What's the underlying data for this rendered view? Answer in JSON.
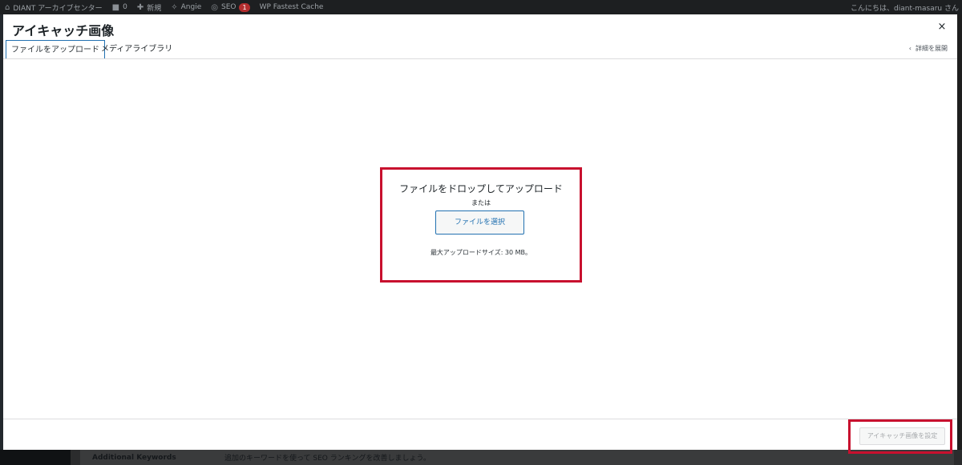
{
  "adminbar": {
    "site_name": "DIANT アーカイブセンター",
    "comments_count": "0",
    "new_label": "新規",
    "angie_label": "Angie",
    "seo_label": "SEO",
    "seo_badge": "1",
    "cache_label": "WP Fastest Cache",
    "greeting": "こんにちは、diant-masaru さん"
  },
  "background": {
    "row_key": "Additional Keywords",
    "row_value": "追加のキーワードを使って SEO ランキングを改善しましょう。"
  },
  "modal": {
    "title": "アイキャッチ画像",
    "close_glyph": "×",
    "tabs": [
      {
        "label": "ファイルをアップロード",
        "active": true
      },
      {
        "label": "メディアライブラリ",
        "active": false
      }
    ],
    "toggle_details": "詳細を展開",
    "toggle_chevron": "‹",
    "uploader": {
      "drop_text": "ファイルをドロップしてアップロード",
      "or_text": "または",
      "select_button": "ファイルを選択",
      "max_size": "最大アップロードサイズ: 30 MB。"
    },
    "footer": {
      "set_button": "アイキャッチ画像を設定"
    }
  },
  "colors": {
    "highlight": "#c8102e",
    "link": "#2271b1",
    "adminbar_bg": "#1d1f21"
  }
}
